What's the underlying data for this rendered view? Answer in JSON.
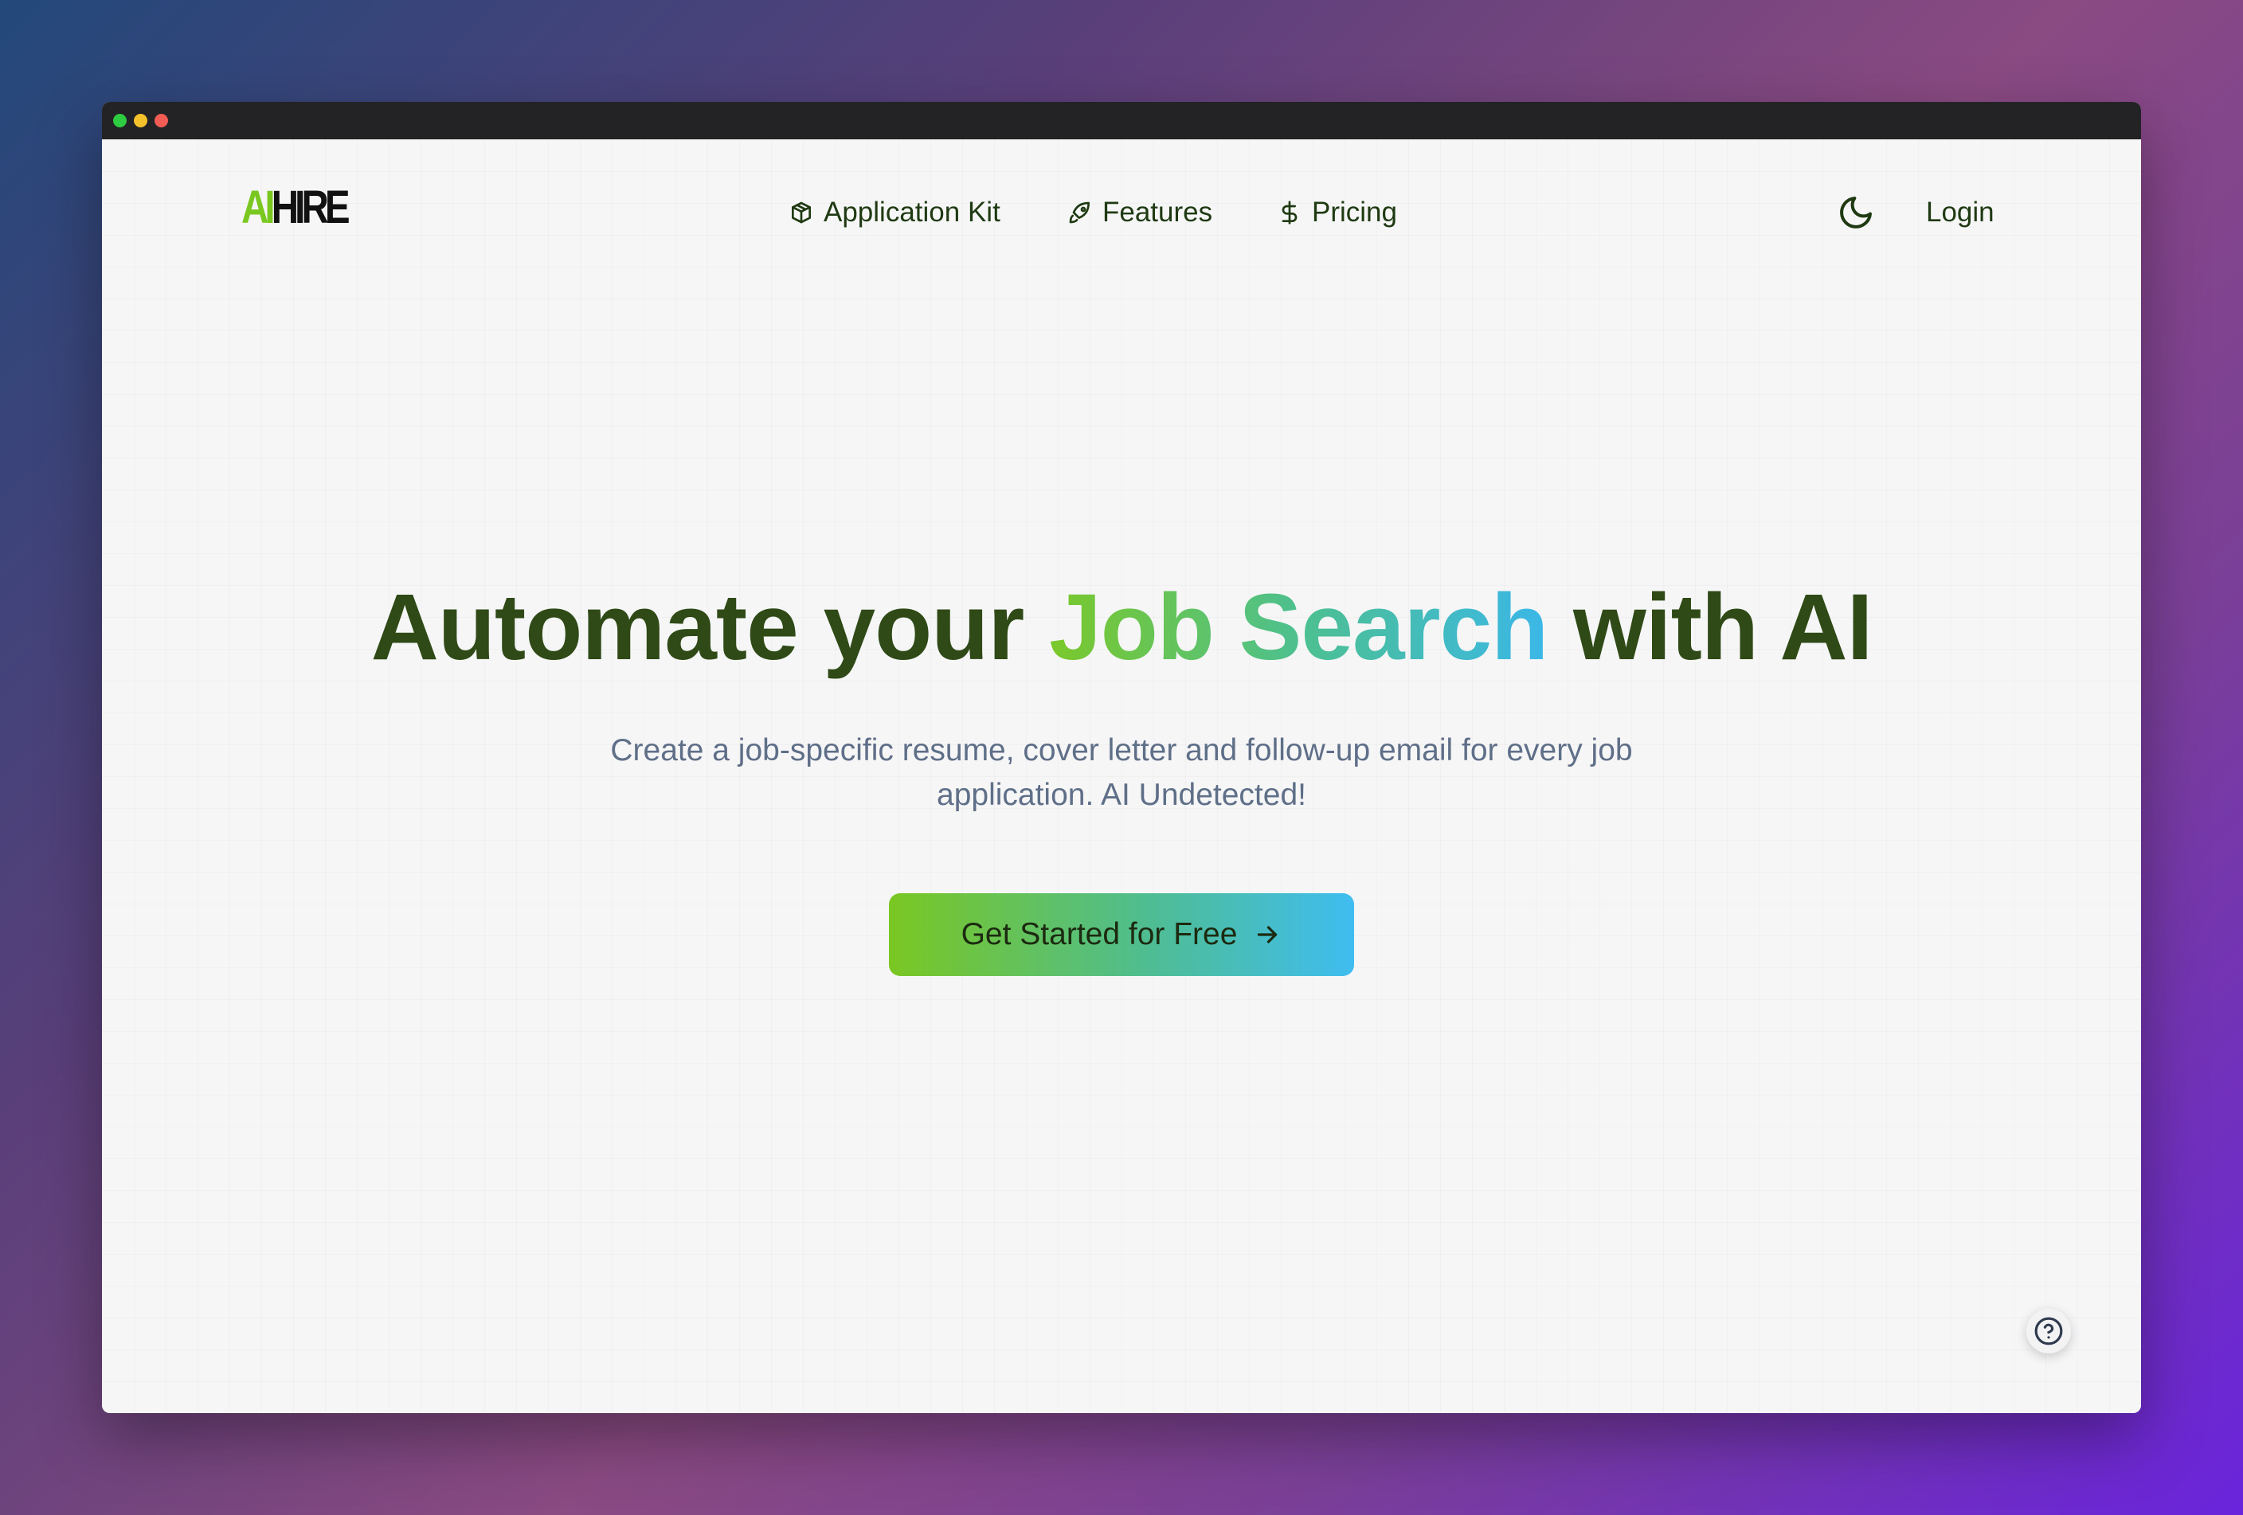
{
  "window": {
    "controls": [
      "green",
      "yellow",
      "red"
    ]
  },
  "brand": {
    "logo_ai": "AI",
    "logo_hire": "HIRE",
    "accent_color": "#7ac720"
  },
  "nav": {
    "items": [
      {
        "label": "Application Kit",
        "icon": "package-icon"
      },
      {
        "label": "Features",
        "icon": "rocket-icon"
      },
      {
        "label": "Pricing",
        "icon": "dollar-icon"
      }
    ],
    "theme_toggle_icon": "moon-icon",
    "login_label": "Login"
  },
  "hero": {
    "title_before": "Automate your",
    "title_highlight": "Job Search",
    "title_after": "with AI",
    "subtitle": "Create a job-specific resume, cover letter and follow-up email for every job application. AI Undetected!",
    "cta_label": "Get Started for Free",
    "cta_icon": "arrow-right-icon"
  },
  "help": {
    "icon": "help-circle-icon"
  }
}
